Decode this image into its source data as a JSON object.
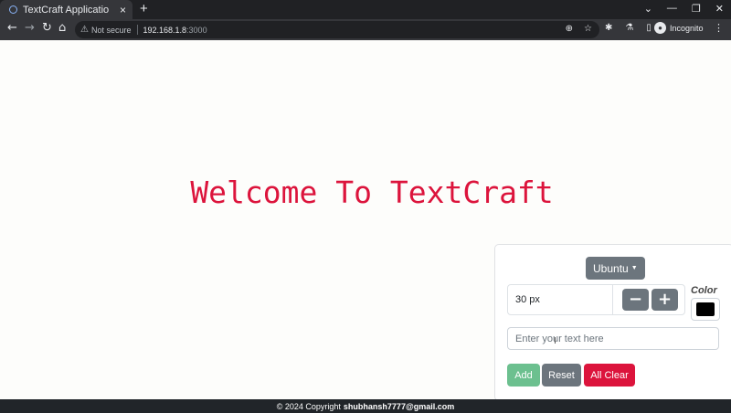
{
  "browser": {
    "tab_title": "TextCraft Applicatio",
    "tab_close": "×",
    "new_tab": "+",
    "not_secure": "Not secure",
    "host": "192.168.1.8",
    "port": ":3000",
    "incognito": "Incognito",
    "icons": [
      "react-favicon",
      "back-arrow-icon",
      "forward-arrow-icon",
      "reload-icon",
      "home-icon",
      "warning-icon",
      "zoom-icon",
      "star-icon",
      "extensions-icon",
      "flask-icon",
      "sidebar-icon",
      "incognito-icon",
      "menu-icon"
    ]
  },
  "main": {
    "heading": "Welcome To TextCraft",
    "heading_color": "#dc143c"
  },
  "panel": {
    "font_button": "Ubuntu",
    "font_size_value": "30 px",
    "decrement_label": "−",
    "increment_label": "+",
    "color_label": "Color",
    "color_value": "#000000",
    "text_placeholder": "Enter your text here",
    "add_label": "Add",
    "reset_label": "Reset",
    "clear_label": "All Clear"
  },
  "footer": {
    "copyright": "© 2024 Copyright",
    "email": "shubhansh7777@gmail.com"
  }
}
